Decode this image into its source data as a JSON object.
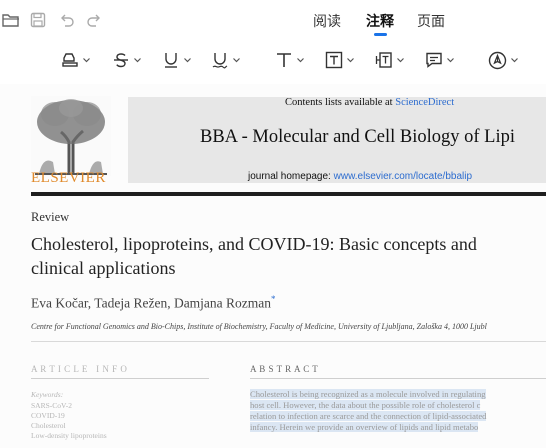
{
  "toolbar": {
    "tabs": [
      {
        "label": "阅读"
      },
      {
        "label": "注释"
      },
      {
        "label": "页面"
      }
    ],
    "active_tab": "注释",
    "accent_color": "#1a73e8"
  },
  "annotation_tools": [
    {
      "icon": "highlighter-icon"
    },
    {
      "icon": "strikethrough-icon"
    },
    {
      "icon": "underline-icon"
    },
    {
      "icon": "squiggly-underline-icon"
    },
    {
      "icon": "text-icon"
    },
    {
      "icon": "text-box-icon"
    },
    {
      "icon": "text-callout-icon"
    },
    {
      "icon": "comment-icon"
    },
    {
      "icon": "pen-icon"
    }
  ],
  "document": {
    "contents_prefix": "Contents lists available at ",
    "contents_link": "ScienceDirect",
    "journal_title": "BBA - Molecular and Cell Biology of Lipi",
    "homepage_prefix": "journal homepage: ",
    "homepage_link": "www.elsevier.com/locate/bbalip",
    "publisher": "ELSEVIER",
    "section": "Review",
    "title_line1": "Cholesterol, lipoproteins, and COVID-19: Basic concepts and",
    "title_line2": "clinical applications",
    "authors": "Eva Kočar, Tadeja Režen, Damjana Rozman",
    "author_marker": "*",
    "affiliation": "Centre for Functional Genomics and Bio-Chips, Institute of Biochemistry, Faculty of Medicine, University of Ljubljana, Zaloška 4, 1000 Ljubl",
    "article_info_heading": "A R T I C L E   I N F O",
    "keywords_heading": "Keywords:",
    "keywords": [
      "SARS-CoV-2",
      "COVID-19",
      "Cholesterol",
      "Low-density lipoproteins"
    ],
    "abstract_heading": "A B S T R A C T",
    "abstract_lines": [
      "Cholesterol is being recognized as a molecule involved in regulating",
      "host cell. However, the data about the possible role of cholesterol c",
      "relation to infection are scarce and the connection of lipid-associated",
      "infancy. Herein we provide an overview of lipids and lipid metabo"
    ],
    "link_color": "#2c6ccf",
    "publisher_color": "#e08a2b"
  }
}
